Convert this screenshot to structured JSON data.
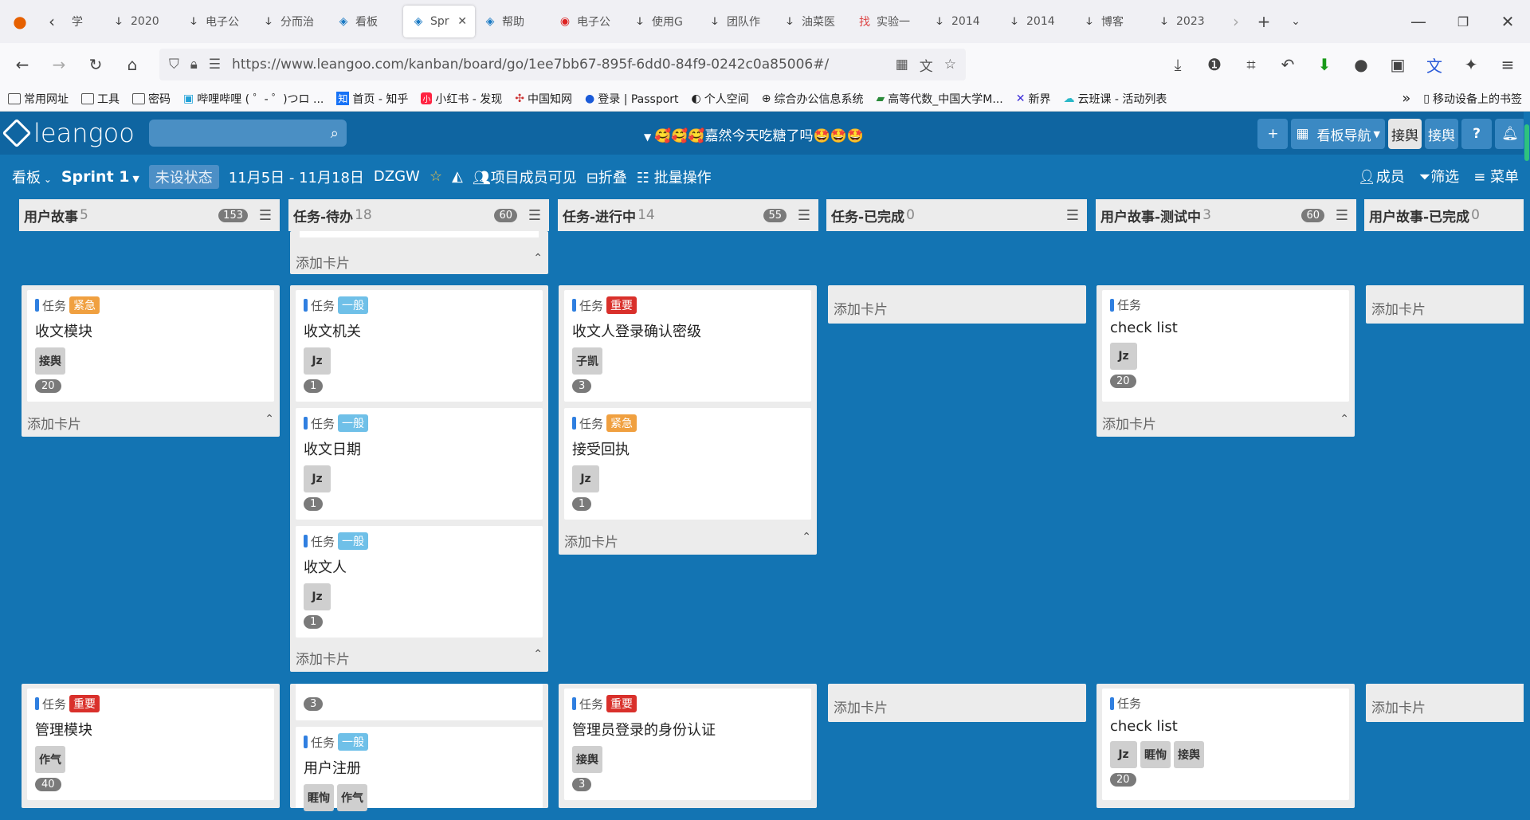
{
  "browser": {
    "tabs": [
      {
        "label": "学"
      },
      {
        "label": "2020"
      },
      {
        "label": "电子公"
      },
      {
        "label": "分而治"
      },
      {
        "label": "看板"
      },
      {
        "label": "Spr"
      },
      {
        "label": "帮助"
      },
      {
        "label": "电子公"
      },
      {
        "label": "使用G"
      },
      {
        "label": "团队作"
      },
      {
        "label": "油菜医"
      },
      {
        "label": "实验一"
      },
      {
        "label": "2014"
      },
      {
        "label": "2014"
      },
      {
        "label": "博客"
      },
      {
        "label": "2023"
      }
    ],
    "url": "https://www.leangoo.com/kanban/board/go/1ee7bb67-895f-6dd0-84f9-0242c0a85006#/",
    "bookmarks": [
      "常用网址",
      "工具",
      "密码",
      "哔哩哔哩 ( ゜- ゜)つロ ...",
      "首页 - 知乎",
      "小红书 - 发现",
      "中国知网",
      "登录 | Passport",
      "个人空间",
      "综合办公信息系统",
      "高等代数_中国大学M...",
      "新界",
      "云班课 - 活动列表"
    ],
    "mobile_bookmarks": "移动设备上的书签"
  },
  "app": {
    "logo": "leangoo",
    "board_title": "🥰🥰🥰嘉然今天吃糖了吗🤩🤩🤩",
    "top_buttons": {
      "add": "+",
      "nav": "看板导航",
      "user1": "接舆",
      "user2": "接舆",
      "help": "?"
    },
    "subbar": {
      "board": "看板",
      "sprint": "Sprint 1",
      "state": "未设状态",
      "dates": "11月5日 - 11月18日",
      "project": "DZGW",
      "members_visible": "项目成员可见",
      "fold": "折叠",
      "batch": "批量操作",
      "members": "成员",
      "filter": "筛选",
      "menu": "菜单"
    },
    "columns": [
      {
        "name": "用户故事",
        "count": "5",
        "wip": "153"
      },
      {
        "name": "任务-待办",
        "count": "18",
        "wip": "60"
      },
      {
        "name": "任务-进行中",
        "count": "14",
        "wip": "55"
      },
      {
        "name": "任务-已完成",
        "count": "0",
        "wip": ""
      },
      {
        "name": "用户故事-测试中",
        "count": "3",
        "wip": "60"
      },
      {
        "name": "用户故事-已完成",
        "count": "0",
        "wip": ""
      }
    ],
    "add_card": "添加卡片",
    "task_label": "任务",
    "cards": {
      "c1": {
        "priority": "紧急",
        "title": "收文模块",
        "members": [
          "接舆"
        ],
        "points": "20"
      },
      "c2": {
        "priority": "一般",
        "title": "收文机关",
        "members": [
          "Jz"
        ],
        "points": "1"
      },
      "c3": {
        "priority": "一般",
        "title": "收文日期",
        "members": [
          "Jz"
        ],
        "points": "1"
      },
      "c4": {
        "priority": "一般",
        "title": "收文人",
        "members": [
          "Jz"
        ],
        "points": "1"
      },
      "c5": {
        "priority": "重要",
        "title": "收文人登录确认密级",
        "members": [
          "子凯"
        ],
        "points": "3"
      },
      "c6": {
        "priority": "紧急",
        "title": "接受回执",
        "members": [
          "Jz"
        ],
        "points": "1"
      },
      "c7": {
        "priority": "",
        "title": "check list",
        "members": [
          "Jz"
        ],
        "points": "20"
      },
      "c8": {
        "priority": "重要",
        "title": "管理模块",
        "members": [
          "作气"
        ],
        "points": "40"
      },
      "c9": {
        "priority": "",
        "title": "",
        "members": [],
        "points": "3"
      },
      "c10": {
        "priority": "一般",
        "title": "用户注册",
        "members": [
          "睚恂",
          "作气"
        ],
        "points": ""
      },
      "c11": {
        "priority": "重要",
        "title": "管理员登录的身份认证",
        "members": [
          "接舆"
        ],
        "points": "3"
      },
      "c12": {
        "priority": "",
        "title": "check list",
        "members": [
          "Jz",
          "睚恂",
          "接舆"
        ],
        "points": "20"
      }
    }
  }
}
